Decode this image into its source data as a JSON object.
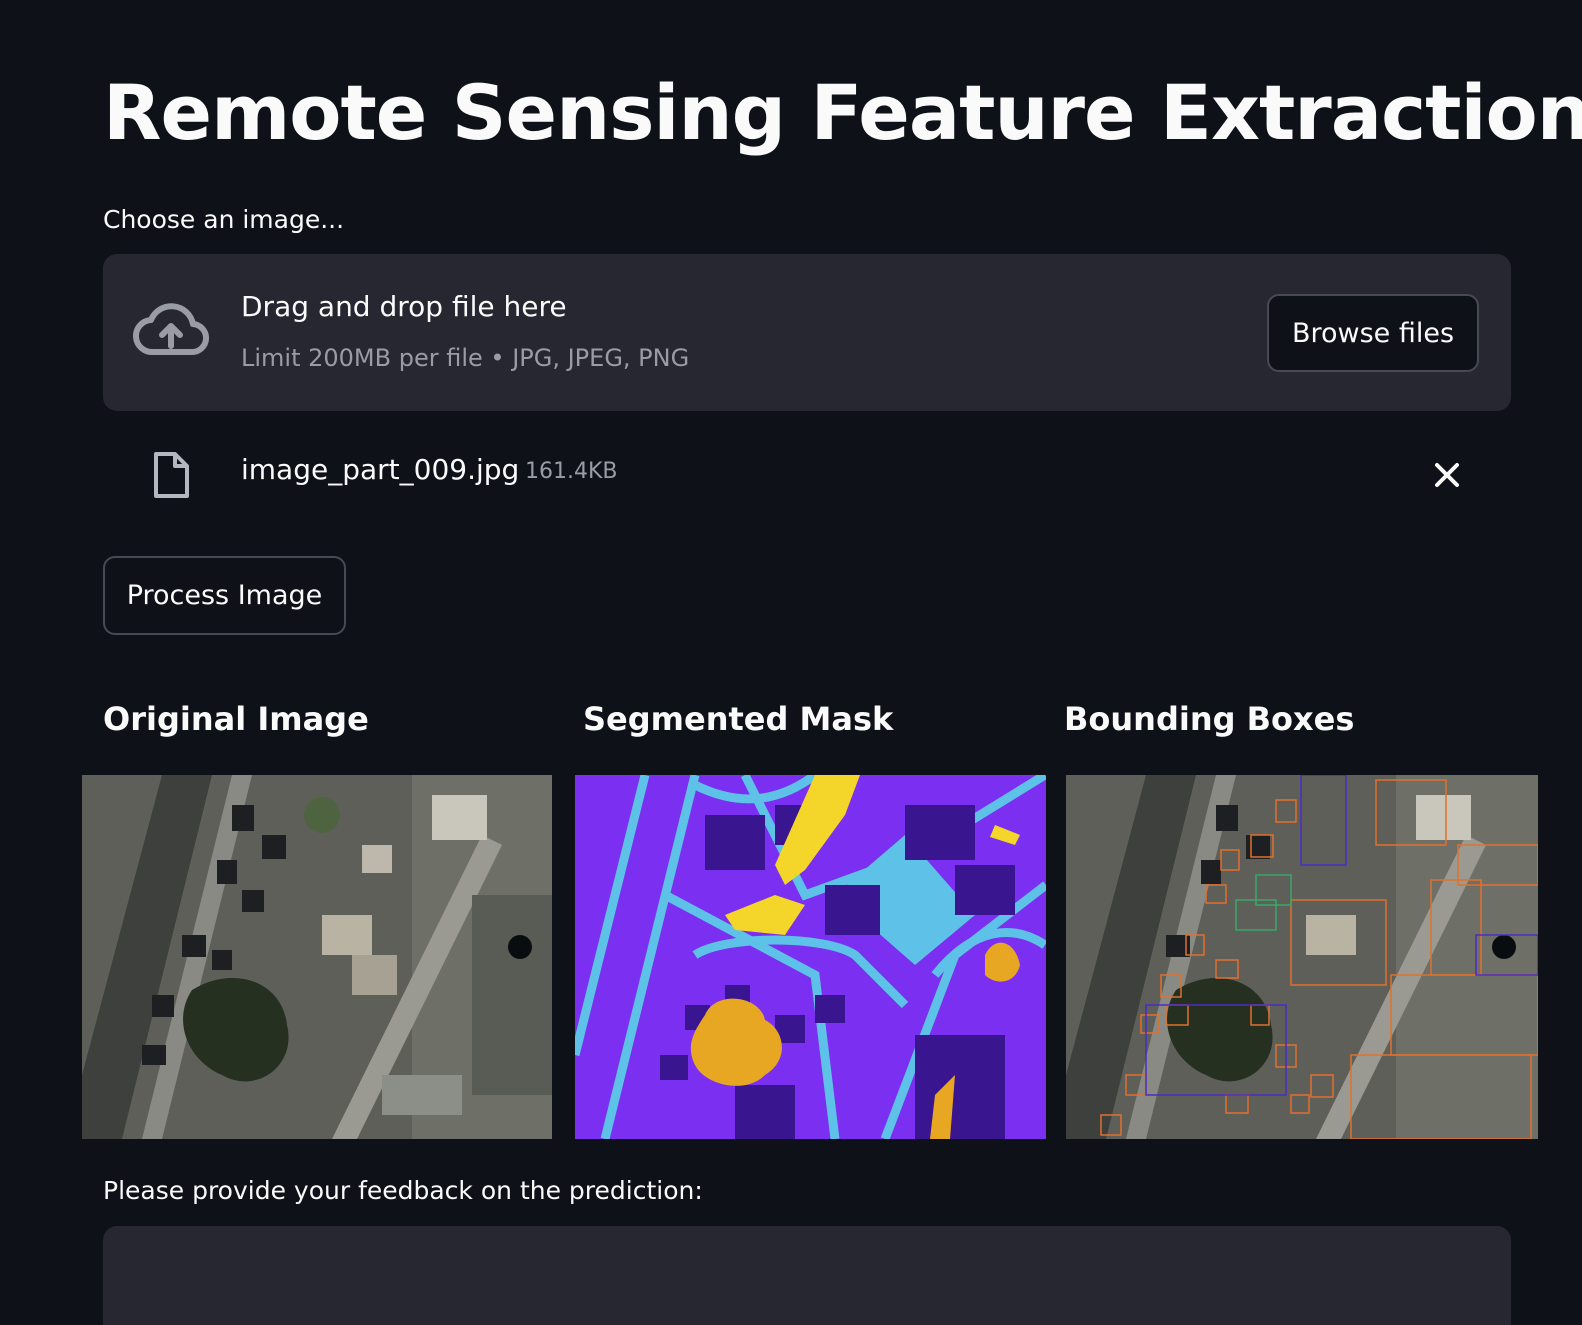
{
  "page": {
    "title": "Remote Sensing Feature Extraction"
  },
  "uploader": {
    "label": "Choose an image...",
    "drop_title": "Drag and drop file here",
    "drop_subtitle": "Limit 200MB per file • JPG, JPEG, PNG",
    "browse_label": "Browse files",
    "icon": "cloud-upload-icon"
  },
  "uploaded_file": {
    "name": "image_part_009.jpg",
    "size": "161.4KB",
    "icon": "file-icon",
    "remove_icon": "close-icon"
  },
  "actions": {
    "process_label": "Process Image"
  },
  "results": {
    "columns": [
      {
        "title": "Original Image"
      },
      {
        "title": "Segmented Mask"
      },
      {
        "title": "Bounding Boxes"
      }
    ]
  },
  "feedback": {
    "label": "Please provide your feedback on the prediction:",
    "value": ""
  },
  "colors": {
    "background": "#0e1117",
    "panel": "#262730",
    "text": "#fafafa",
    "muted": "#9a9ca5",
    "mask_background": "#7b2ff0",
    "mask_buildings": "#3a1590",
    "mask_roads": "#5ec2e8",
    "mask_vegetation": "#e8a722",
    "mask_yellow": "#f4d52a"
  }
}
